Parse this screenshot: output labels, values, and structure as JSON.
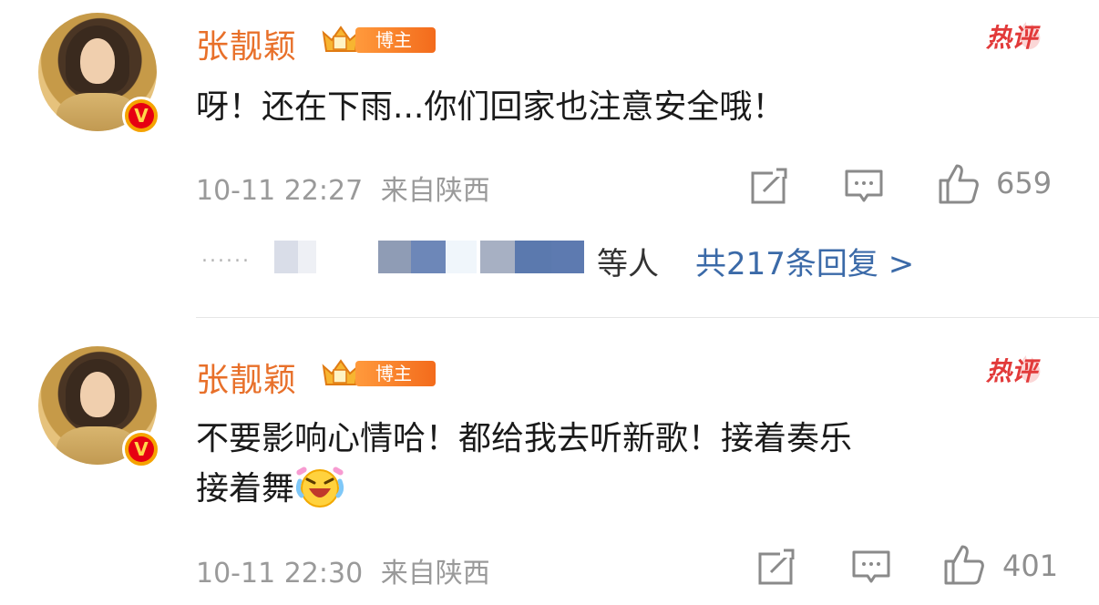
{
  "comments": [
    {
      "user": "张靓颖",
      "badge": "博主",
      "hot_label": "热评",
      "text": "呀！还在下雨...你们回家也注意安全哦！",
      "time": "10-11 22:27",
      "location": "来自陕西",
      "likes": "659",
      "replies_prefix": "......",
      "replies_suffix": "等人",
      "replies_total": "共217条回复 >"
    },
    {
      "user": "张靓颖",
      "badge": "博主",
      "hot_label": "热评",
      "text_line1": "不要影响心情哈！都给我去听新歌！接着奏乐",
      "text_line2": "接着舞",
      "time": "10-11 22:30",
      "location": "来自陕西",
      "likes": "401"
    }
  ],
  "colors": {
    "name": "#e8702a",
    "link": "#3b6aa8",
    "meta": "#9a9a9a",
    "hot": "#e23a3a"
  },
  "icons": [
    "avatar",
    "verified-v-icon",
    "crown-icon",
    "hot-flame-icon",
    "repost-icon",
    "comment-icon",
    "like-icon",
    "laughing-emoji"
  ]
}
